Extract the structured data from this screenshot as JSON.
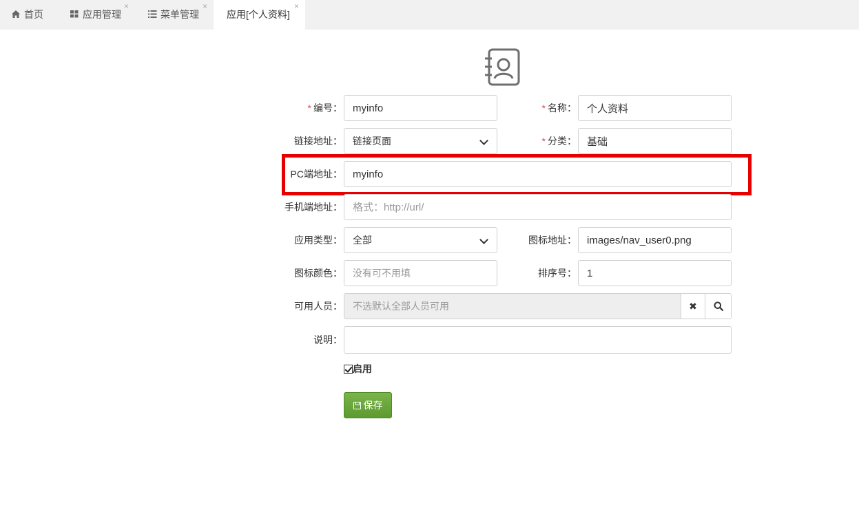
{
  "tabs": [
    {
      "icon": "home-icon",
      "label": "首页",
      "closable": false
    },
    {
      "icon": "grid-icon",
      "label": "应用管理",
      "closable": true
    },
    {
      "icon": "list-icon",
      "label": "菜单管理",
      "closable": true
    },
    {
      "icon": "",
      "label": "应用[个人资料]",
      "closable": true,
      "active": true
    }
  ],
  "tab_close_glyph": "×",
  "app_icon": "contact-card-icon",
  "form": {
    "code": {
      "label": "编号：",
      "required": "*",
      "value": "myinfo"
    },
    "name": {
      "label": "名称：",
      "required": "*",
      "value": "个人资料"
    },
    "link": {
      "label": "链接地址：",
      "value": "链接页面"
    },
    "category": {
      "label": "分类：",
      "required": "*",
      "value": "基础"
    },
    "pc_url": {
      "label": "PC端地址：",
      "value": "myinfo"
    },
    "mobile_url": {
      "label": "手机端地址：",
      "placeholder": "格式：http://url/"
    },
    "app_type": {
      "label": "应用类型：",
      "value": "全部"
    },
    "icon_url": {
      "label": "图标地址：",
      "value": "images/nav_user0.png"
    },
    "icon_color": {
      "label": "图标颜色：",
      "placeholder": "没有可不用填"
    },
    "sort": {
      "label": "排序号：",
      "value": "1"
    },
    "users": {
      "label": "可用人员：",
      "placeholder": "不选默认全部人员可用",
      "clear_glyph": "✖",
      "search_icon": "search-icon"
    },
    "desc": {
      "label": "说明：",
      "value": ""
    },
    "enabled": {
      "label": "启用",
      "checked": true
    }
  },
  "save_button": {
    "label": "保存",
    "icon": "floppy-icon"
  },
  "highlight_color": "#e60000"
}
